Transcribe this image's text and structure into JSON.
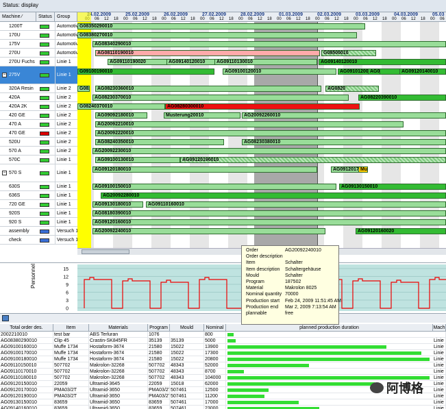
{
  "status": {
    "label": "Status: display"
  },
  "columns": {
    "machine": "Machine ⁄",
    "status": "Status",
    "group": "Group"
  },
  "dates": [
    "24.02.2009",
    "25.02.2009",
    "26.02.2009",
    "27.02.2009",
    "28.02.2009",
    "01.03.2009",
    "02.03.2009",
    "03.03.2009",
    "04.03.2009",
    "05.03"
  ],
  "hours": [
    "00",
    "06",
    "12",
    "18"
  ],
  "machines": [
    {
      "name": "1200T",
      "status_color": "#33cc33",
      "group": "Automotive"
    },
    {
      "name": "170U",
      "status_color": "#33cc33",
      "group": "Automotive"
    },
    {
      "name": "175V",
      "status_color": "#33cc33",
      "group": "Automotive"
    },
    {
      "name": "270U",
      "status_color": "#33cc33",
      "group": "Automotive"
    },
    {
      "name": "270U Fuchs",
      "status_color": "#33cc33",
      "group": "Linie 1"
    },
    {
      "name": "275V",
      "status_color": "#33cc33",
      "group": "Linie 1"
    },
    {
      "name": "320A Resin",
      "status_color": "#33cc33",
      "group": "Linie 2"
    },
    {
      "name": "420A",
      "status_color": "#33cc33",
      "group": "Linie 2"
    },
    {
      "name": "420A 2K",
      "status_color": "#33cc33",
      "group": "Linie 2"
    },
    {
      "name": "420 GE",
      "status_color": "#33cc33",
      "group": "Linie 2"
    },
    {
      "name": "470 A",
      "status_color": "#33cc33",
      "group": "Linie 2"
    },
    {
      "name": "470 GE",
      "status_color": "#dd0000",
      "group": "Linie 2"
    },
    {
      "name": "520U",
      "status_color": "#33cc33",
      "group": "Linie 2"
    },
    {
      "name": "570 A",
      "status_color": "#33cc33",
      "group": "Linie 2"
    },
    {
      "name": "570C",
      "status_color": "#33cc33",
      "group": "Linie 1"
    },
    {
      "name": "570 S",
      "status_color": "#33cc33",
      "group": "Linie 1"
    },
    {
      "name": "630S",
      "status_color": "#33cc33",
      "group": "Linie 1"
    },
    {
      "name": "636S",
      "status_color": "#33cc33",
      "group": "Linie 1"
    },
    {
      "name": "720 GE",
      "status_color": "#33cc33",
      "group": "Linie 1"
    },
    {
      "name": "920S",
      "status_color": "#33cc33",
      "group": "Linie 1"
    },
    {
      "name": "920 S",
      "status_color": "#33cc33",
      "group": "Linie 1"
    },
    {
      "name": "assembly",
      "status_color": "#3a6fd6",
      "group": "Versuch 1"
    },
    {
      "name": "check",
      "status_color": "#3a6fd6",
      "group": "Versuch 1"
    }
  ],
  "bars": [
    {
      "label": "G08350290010",
      "color": "#99dd99"
    },
    {
      "label": "G08380270010",
      "color": "#99dd99"
    },
    {
      "label": "AG08340290010",
      "color": "#99dd99"
    },
    {
      "label": "AG08110190010",
      "color": "#ffaaaa"
    },
    {
      "label": "G08500010",
      "color": "#99dd99"
    },
    {
      "label": "AG09110190020",
      "color": "#99dd99"
    },
    {
      "label": "AG09140120010",
      "color": "#99dd99"
    },
    {
      "label": "AG09110130010",
      "color": "#99dd99"
    },
    {
      "label": "AG09140120010",
      "color": "#33bb33"
    },
    {
      "label": "G09100190010",
      "color": "#33bb33"
    },
    {
      "label": "AG09100120010",
      "color": "#99dd99"
    },
    {
      "label": "AG09101200",
      "color": "#33bb33"
    },
    {
      "label": "AG09120140010",
      "color": "#33bb33"
    },
    {
      "label": "AG09",
      "color": "#33bb33"
    },
    {
      "label": "G082",
      "color": "#99dd99"
    },
    {
      "label": "AG08230360010",
      "color": "#99dd99"
    },
    {
      "label": "AG0820",
      "color": "#99dd99"
    },
    {
      "label": "AG08230370010",
      "color": "#99dd99"
    },
    {
      "label": "AG08220390010",
      "color": "#33bb33"
    },
    {
      "label": "G08240370010",
      "color": "#99dd99"
    },
    {
      "label": "AG08280300010",
      "color": "#ee1111"
    },
    {
      "label": "AG09092180010",
      "color": "#99dd99"
    },
    {
      "label": "Musterung20010",
      "color": "#99dd99"
    },
    {
      "label": "AG20092260010",
      "color": "#99dd99"
    },
    {
      "label": "AG20092210010",
      "color": "#99dd99"
    },
    {
      "label": "AG20092220010",
      "color": "#99dd99"
    },
    {
      "label": "AG08240350010",
      "color": "#99dd99"
    },
    {
      "label": "AG08230380010",
      "color": "#99dd99"
    },
    {
      "label": "AG20092230010",
      "color": "#99dd99"
    },
    {
      "label": "AG09100130010",
      "color": "#99dd99"
    },
    {
      "label": "AG09120190010",
      "color": "#99dd99"
    },
    {
      "label": "AG09120180010",
      "color": "#99dd99"
    },
    {
      "label": "AG09120170",
      "color": "#99dd99"
    },
    {
      "label": "Mus",
      "color": "#ffcc00"
    },
    {
      "label": "AG09100150010",
      "color": "#99dd99"
    },
    {
      "label": "AG09130150010",
      "color": "#33bb33"
    },
    {
      "label": "AG20092280010",
      "color": "#33bb33"
    },
    {
      "label": "AG09130180010",
      "color": "#99dd99"
    },
    {
      "label": "AG09110160010",
      "color": "#99dd99"
    },
    {
      "label": "AG08180390010",
      "color": "#99dd99"
    },
    {
      "label": "AG09120160010",
      "color": "#99dd99"
    },
    {
      "label": "AG20092240010",
      "color": "#99dd99"
    },
    {
      "label": "AG09120160020",
      "color": "#33bb33"
    }
  ],
  "tooltip": {
    "rows": [
      {
        "k": "Order",
        "v": "AG20092240010"
      },
      {
        "k": "Order description",
        "v": ""
      },
      {
        "k": "Item",
        "v": "Schalter"
      },
      {
        "k": "Item description",
        "v": "Schaltergehäuse"
      },
      {
        "k": "Mould",
        "v": "Schalter"
      },
      {
        "k": "Program",
        "v": "187502"
      },
      {
        "k": "Material",
        "v": "Makrolon 8025"
      },
      {
        "k": "Nominal quantity",
        "v": "70000"
      },
      {
        "k": "Production start",
        "v": "Feb 24, 2009 11:51:45 AM"
      },
      {
        "k": "Production end",
        "v": "Mar 2, 2009 7:13:54 AM"
      },
      {
        "k": "plannable",
        "v": "free"
      }
    ]
  },
  "personnel": {
    "ylabel": "Personnel",
    "ticks": [
      "15",
      "12",
      "9",
      "6",
      "3",
      "0"
    ]
  },
  "table": {
    "headers": [
      "Total order des.",
      "Item",
      "Materials",
      "Program",
      "Mould",
      "Nominal",
      "planned production duration",
      "Mach"
    ],
    "rows": [
      {
        "order": "2002210010",
        "item": "test bar",
        "material": "ABS Terluran",
        "program": "1076",
        "mould": "",
        "nominal": "800",
        "progress": 0.03,
        "machine": ""
      },
      {
        "order": "AG08380290010",
        "item": "Clip 45",
        "material": "Crastin-SK845FR",
        "program": "35139",
        "mould": "35139",
        "nominal": "5000",
        "progress": 0.04,
        "machine": "Linie"
      },
      {
        "order": "AG09100160010",
        "item": "Muffe 1734",
        "material": "Hostaform-3674",
        "program": "21580",
        "mould": "15022",
        "nominal": "13900",
        "progress": 0.78,
        "machine": "Linie"
      },
      {
        "order": "AG09100170010",
        "item": "Muffe 1734",
        "material": "Hostaform-3674",
        "program": "21580",
        "mould": "15022",
        "nominal": "17300",
        "progress": 0.95,
        "machine": "Linie"
      },
      {
        "order": "AG09100180010",
        "item": "Muffe 1734",
        "material": "Hostaform-3674",
        "program": "21580",
        "mould": "15022",
        "nominal": "20800",
        "progress": 0.99,
        "machine": "Linie"
      },
      {
        "order": "AG09110150010",
        "item": "507702",
        "material": "Makrolon-32268",
        "program": "507702",
        "mould": "48343",
        "nominal": "52000",
        "progress": 0.4,
        "machine": "Linie"
      },
      {
        "order": "AG09110170010",
        "item": "507702",
        "material": "Makrolon-32268",
        "program": "507702",
        "mould": "48343",
        "nominal": "8700",
        "progress": 0.08,
        "machine": "Linie"
      },
      {
        "order": "AG09110180010",
        "item": "507702",
        "material": "Makrolon-32268",
        "program": "507702",
        "mould": "48343",
        "nominal": "104000",
        "progress": 0.99,
        "machine": "Linie"
      },
      {
        "order": "AG09120150010",
        "item": "22059",
        "material": "Ultramid-3645",
        "program": "22059",
        "mould": "15018",
        "nominal": "62000",
        "progress": 0.72,
        "machine": "Linie"
      },
      {
        "order": "AG09120170010",
        "item": "PMA03/2T",
        "material": "Ultramid-3650",
        "program": "PMA03/2T",
        "mould": "507461",
        "nominal": "12500",
        "progress": 0.2,
        "machine": "Linie"
      },
      {
        "order": "AG09120190010",
        "item": "PMA03/2T",
        "material": "Ultramid-3650",
        "program": "PMA03/2T",
        "mould": "507461",
        "nominal": "11200",
        "progress": 0.18,
        "machine": "Linie"
      },
      {
        "order": "AG09130150010",
        "item": "83659",
        "material": "Ultramid-3650",
        "program": "83659",
        "mould": "507461",
        "nominal": "17000",
        "progress": 0.35,
        "machine": "Linie"
      },
      {
        "order": "AG09140160010",
        "item": "83659",
        "material": "Ultramid-3650",
        "program": "83659",
        "mould": "507461",
        "nominal": "23000",
        "progress": 0.45,
        "machine": "Linie"
      }
    ]
  },
  "watermark": {
    "text": "阿博格"
  }
}
